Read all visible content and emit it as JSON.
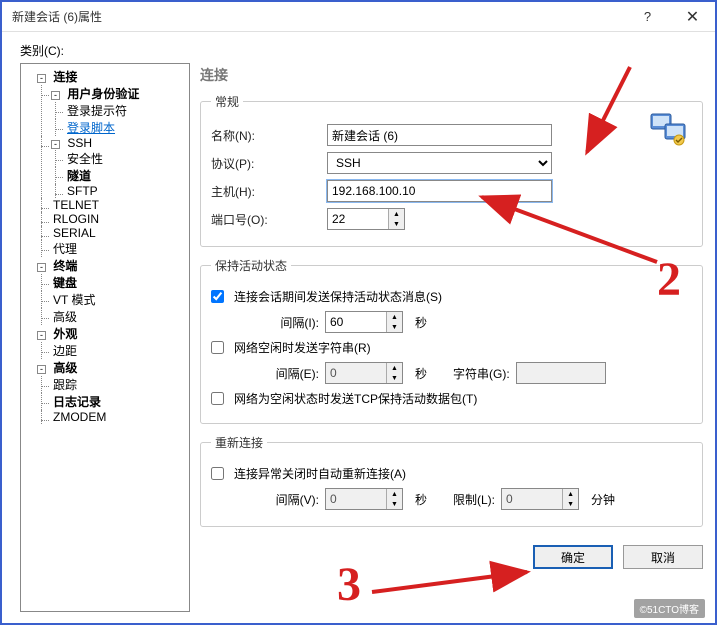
{
  "window": {
    "title": "新建会话 (6)属性",
    "help": "?",
    "close": "✕"
  },
  "category_label": "类别(C):",
  "tree": {
    "connection": "连接",
    "userauth": "用户身份验证",
    "loginprompt": "登录提示符",
    "loginscript": "登录脚本",
    "ssh": "SSH",
    "security": "安全性",
    "tunnel": "隧道",
    "sftp": "SFTP",
    "telnet": "TELNET",
    "rlogin": "RLOGIN",
    "serial": "SERIAL",
    "proxy": "代理",
    "terminal": "终端",
    "keyboard": "键盘",
    "vtmode": "VT 模式",
    "advanced1": "高级",
    "appearance": "外观",
    "margin": "边距",
    "advanced2": "高级",
    "trace": "跟踪",
    "logging": "日志记录",
    "zmodem": "ZMODEM"
  },
  "section_title": "连接",
  "general": {
    "legend": "常规",
    "name_label": "名称(N):",
    "name_value": "新建会话 (6)",
    "protocol_label": "协议(P):",
    "protocol_value": "SSH",
    "host_label": "主机(H):",
    "host_value": "192.168.100.10",
    "port_label": "端口号(O):",
    "port_value": "22"
  },
  "keepalive": {
    "legend": "保持活动状态",
    "send_keepalive_label": "连接会话期间发送保持活动状态消息(S)",
    "send_keepalive_checked": true,
    "interval_i_label": "间隔(I):",
    "interval_i_value": "60",
    "seconds": "秒",
    "idle_string_label": "网络空闲时发送字符串(R)",
    "idle_string_checked": false,
    "interval_e_label": "间隔(E):",
    "interval_e_value": "0",
    "string_g_label": "字符串(G):",
    "string_g_value": "",
    "tcp_keepalive_label": "网络为空闲状态时发送TCP保持活动数据包(T)",
    "tcp_keepalive_checked": false
  },
  "reconnect": {
    "legend": "重新连接",
    "auto_reconnect_label": "连接异常关闭时自动重新连接(A)",
    "auto_reconnect_checked": false,
    "interval_v_label": "间隔(V):",
    "interval_v_value": "0",
    "limit_l_label": "限制(L):",
    "limit_l_value": "0",
    "minutes": "分钟"
  },
  "buttons": {
    "ok": "确定",
    "cancel": "取消"
  },
  "watermark": "©51CTO博客",
  "annotations": {
    "num2": "2",
    "num3": "3"
  }
}
